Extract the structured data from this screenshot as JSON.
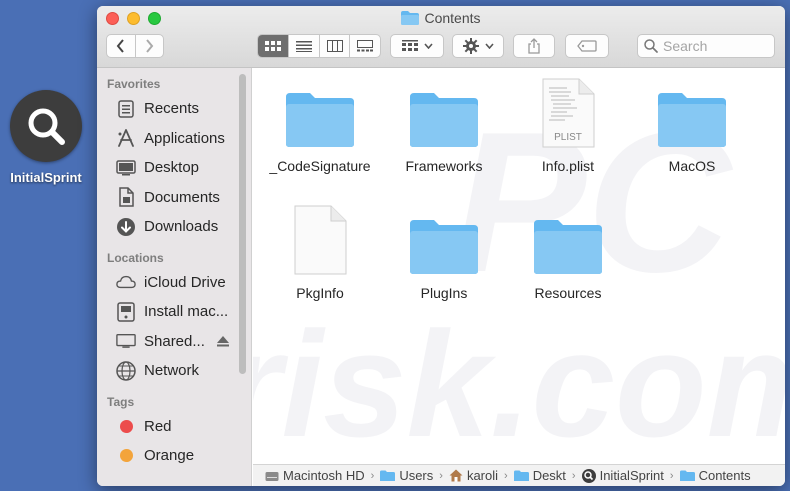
{
  "desktop": {
    "icon_label": "InitialSprint"
  },
  "window": {
    "title": "Contents"
  },
  "toolbar": {
    "search_placeholder": "Search"
  },
  "sidebar": {
    "favorites_header": "Favorites",
    "favorites": [
      {
        "label": "Recents",
        "icon": "recents-icon"
      },
      {
        "label": "Applications",
        "icon": "applications-icon"
      },
      {
        "label": "Desktop",
        "icon": "desktop-icon"
      },
      {
        "label": "Documents",
        "icon": "documents-icon"
      },
      {
        "label": "Downloads",
        "icon": "downloads-icon"
      }
    ],
    "locations_header": "Locations",
    "locations": [
      {
        "label": "iCloud Drive",
        "icon": "cloud-icon"
      },
      {
        "label": "Install mac...",
        "icon": "disk-icon"
      },
      {
        "label": "Shared...",
        "icon": "display-icon"
      },
      {
        "label": "Network",
        "icon": "globe-icon"
      }
    ],
    "tags_header": "Tags",
    "tags": [
      {
        "label": "Red",
        "color": "#ec4c4c"
      },
      {
        "label": "Orange",
        "color": "#f3a43b"
      }
    ]
  },
  "files": [
    {
      "name": "_CodeSignature",
      "kind": "folder"
    },
    {
      "name": "Frameworks",
      "kind": "folder"
    },
    {
      "name": "Info.plist",
      "kind": "plist",
      "badge": "PLIST"
    },
    {
      "name": "MacOS",
      "kind": "folder"
    },
    {
      "name": "PkgInfo",
      "kind": "document"
    },
    {
      "name": "PlugIns",
      "kind": "folder"
    },
    {
      "name": "Resources",
      "kind": "folder"
    }
  ],
  "pathbar": {
    "crumbs": [
      {
        "label": "Macintosh HD",
        "icon": "hard-drive-icon"
      },
      {
        "label": "Users",
        "icon": "users-folder-icon"
      },
      {
        "label": "karoli",
        "icon": "home-icon"
      },
      {
        "label": "Deskt",
        "icon": "desktop-folder-icon"
      },
      {
        "label": "InitialSprint",
        "icon": "app-search-icon"
      },
      {
        "label": "Contents",
        "icon": "folder-icon"
      }
    ]
  },
  "watermark": {
    "text_top": "PC",
    "text_bottom": "risk.com"
  },
  "colors": {
    "folder": "#64b8f0",
    "folder_tab": "#86c8f3",
    "selected_view": "#6e6e6e"
  }
}
